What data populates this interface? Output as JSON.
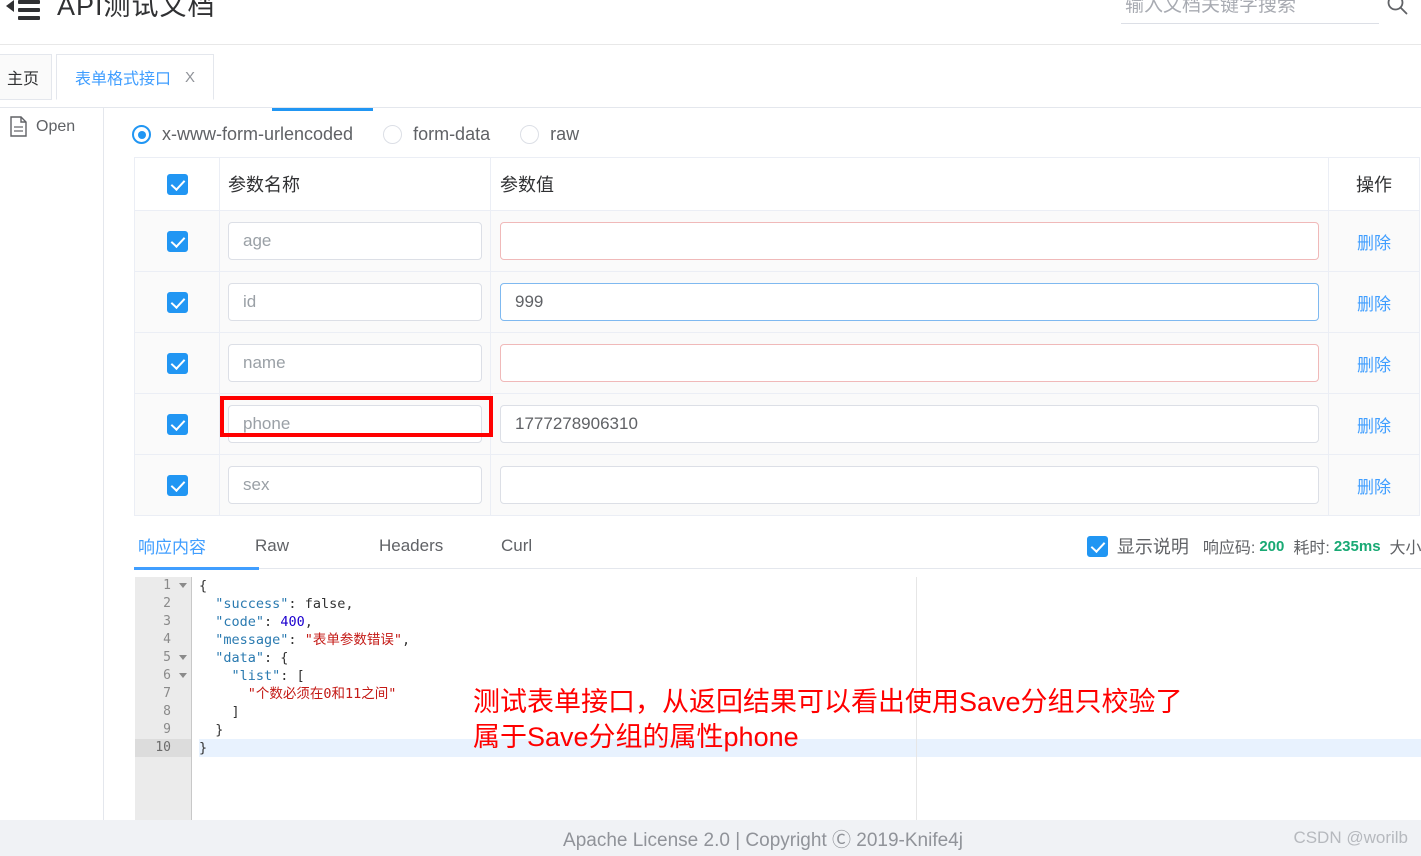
{
  "header": {
    "title": "API测试文档",
    "menu_icon": "hamburger-collapse-icon",
    "search": {
      "placeholder": "输入文档关键字搜索",
      "value": "",
      "icon": "search-icon"
    }
  },
  "tabs": [
    {
      "label": "主页",
      "active": false,
      "closable": false
    },
    {
      "label": "表单格式接口",
      "active": true,
      "closable": true,
      "close_label": "X"
    }
  ],
  "left_rail": {
    "open_label": "Open",
    "open_icon": "document-file-icon"
  },
  "body_type": {
    "options": [
      {
        "label": "x-www-form-urlencoded",
        "selected": true
      },
      {
        "label": "form-data",
        "selected": false
      },
      {
        "label": "raw",
        "selected": false
      }
    ]
  },
  "params_table": {
    "headers": {
      "name": "参数名称",
      "value": "参数值",
      "action": "操作"
    },
    "header_checked": true,
    "delete_label": "删除",
    "rows": [
      {
        "checked": true,
        "name": "age",
        "value": "",
        "value_state": "error",
        "name_marked": false
      },
      {
        "checked": true,
        "name": "id",
        "value": "999",
        "value_state": "focus",
        "name_marked": false
      },
      {
        "checked": true,
        "name": "name",
        "value": "",
        "value_state": "error",
        "name_marked": false
      },
      {
        "checked": true,
        "name": "phone",
        "value": "1777278906310",
        "value_state": "normal",
        "name_marked": true
      },
      {
        "checked": true,
        "name": "sex",
        "value": "",
        "value_state": "normal",
        "name_marked": false
      }
    ]
  },
  "response": {
    "tabs": [
      {
        "label": "响应内容",
        "active": true
      },
      {
        "label": "Raw",
        "active": false
      },
      {
        "label": "Headers",
        "active": false
      },
      {
        "label": "Curl",
        "active": false
      }
    ],
    "show_desc_checked": true,
    "show_desc_label": "显示说明",
    "status_key": "响应码:",
    "status_value": "200",
    "time_key": "耗时:",
    "time_value": "235ms",
    "size_key": "大小:",
    "code_lines": [
      {
        "n": "1",
        "fold": true,
        "highlight": false,
        "tokens": [
          {
            "t": "punc",
            "v": "{"
          }
        ]
      },
      {
        "n": "2",
        "fold": false,
        "highlight": false,
        "tokens": [
          {
            "t": "punc",
            "v": "  "
          },
          {
            "t": "key",
            "v": "\"success\""
          },
          {
            "t": "punc",
            "v": ": "
          },
          {
            "t": "bool",
            "v": "false"
          },
          {
            "t": "punc",
            "v": ","
          }
        ]
      },
      {
        "n": "3",
        "fold": false,
        "highlight": false,
        "tokens": [
          {
            "t": "punc",
            "v": "  "
          },
          {
            "t": "key",
            "v": "\"code\""
          },
          {
            "t": "punc",
            "v": ": "
          },
          {
            "t": "num",
            "v": "400"
          },
          {
            "t": "punc",
            "v": ","
          }
        ]
      },
      {
        "n": "4",
        "fold": false,
        "highlight": false,
        "tokens": [
          {
            "t": "punc",
            "v": "  "
          },
          {
            "t": "key",
            "v": "\"message\""
          },
          {
            "t": "punc",
            "v": ": "
          },
          {
            "t": "str",
            "v": "\"表单参数错误\""
          },
          {
            "t": "punc",
            "v": ","
          }
        ]
      },
      {
        "n": "5",
        "fold": true,
        "highlight": false,
        "tokens": [
          {
            "t": "punc",
            "v": "  "
          },
          {
            "t": "key",
            "v": "\"data\""
          },
          {
            "t": "punc",
            "v": ": {"
          }
        ]
      },
      {
        "n": "6",
        "fold": true,
        "highlight": false,
        "tokens": [
          {
            "t": "punc",
            "v": "    "
          },
          {
            "t": "key",
            "v": "\"list\""
          },
          {
            "t": "punc",
            "v": ": ["
          }
        ]
      },
      {
        "n": "7",
        "fold": false,
        "highlight": false,
        "tokens": [
          {
            "t": "punc",
            "v": "      "
          },
          {
            "t": "str",
            "v": "\"个数必须在0和11之间\""
          }
        ]
      },
      {
        "n": "8",
        "fold": false,
        "highlight": false,
        "tokens": [
          {
            "t": "punc",
            "v": "    ]"
          }
        ]
      },
      {
        "n": "9",
        "fold": false,
        "highlight": false,
        "tokens": [
          {
            "t": "punc",
            "v": "  }"
          }
        ]
      },
      {
        "n": "10",
        "fold": false,
        "highlight": true,
        "tokens": [
          {
            "t": "punc",
            "v": "}"
          }
        ]
      }
    ]
  },
  "annotation": {
    "line1": "测试表单接口，从返回结果可以看出使用Save分组只校验了",
    "line2": "属于Save分组的属性phone",
    "color": "#ff0000"
  },
  "footer": {
    "text": "Apache License 2.0 | Copyright Ⓒ 2019-Knife4j",
    "watermark": "CSDN @worilb"
  },
  "colors": {
    "accent": "#409eff",
    "checkbox": "#2196f3",
    "status_ok": "#19a974",
    "error_border": "#f0b9b9",
    "annotation": "#ff0000"
  }
}
